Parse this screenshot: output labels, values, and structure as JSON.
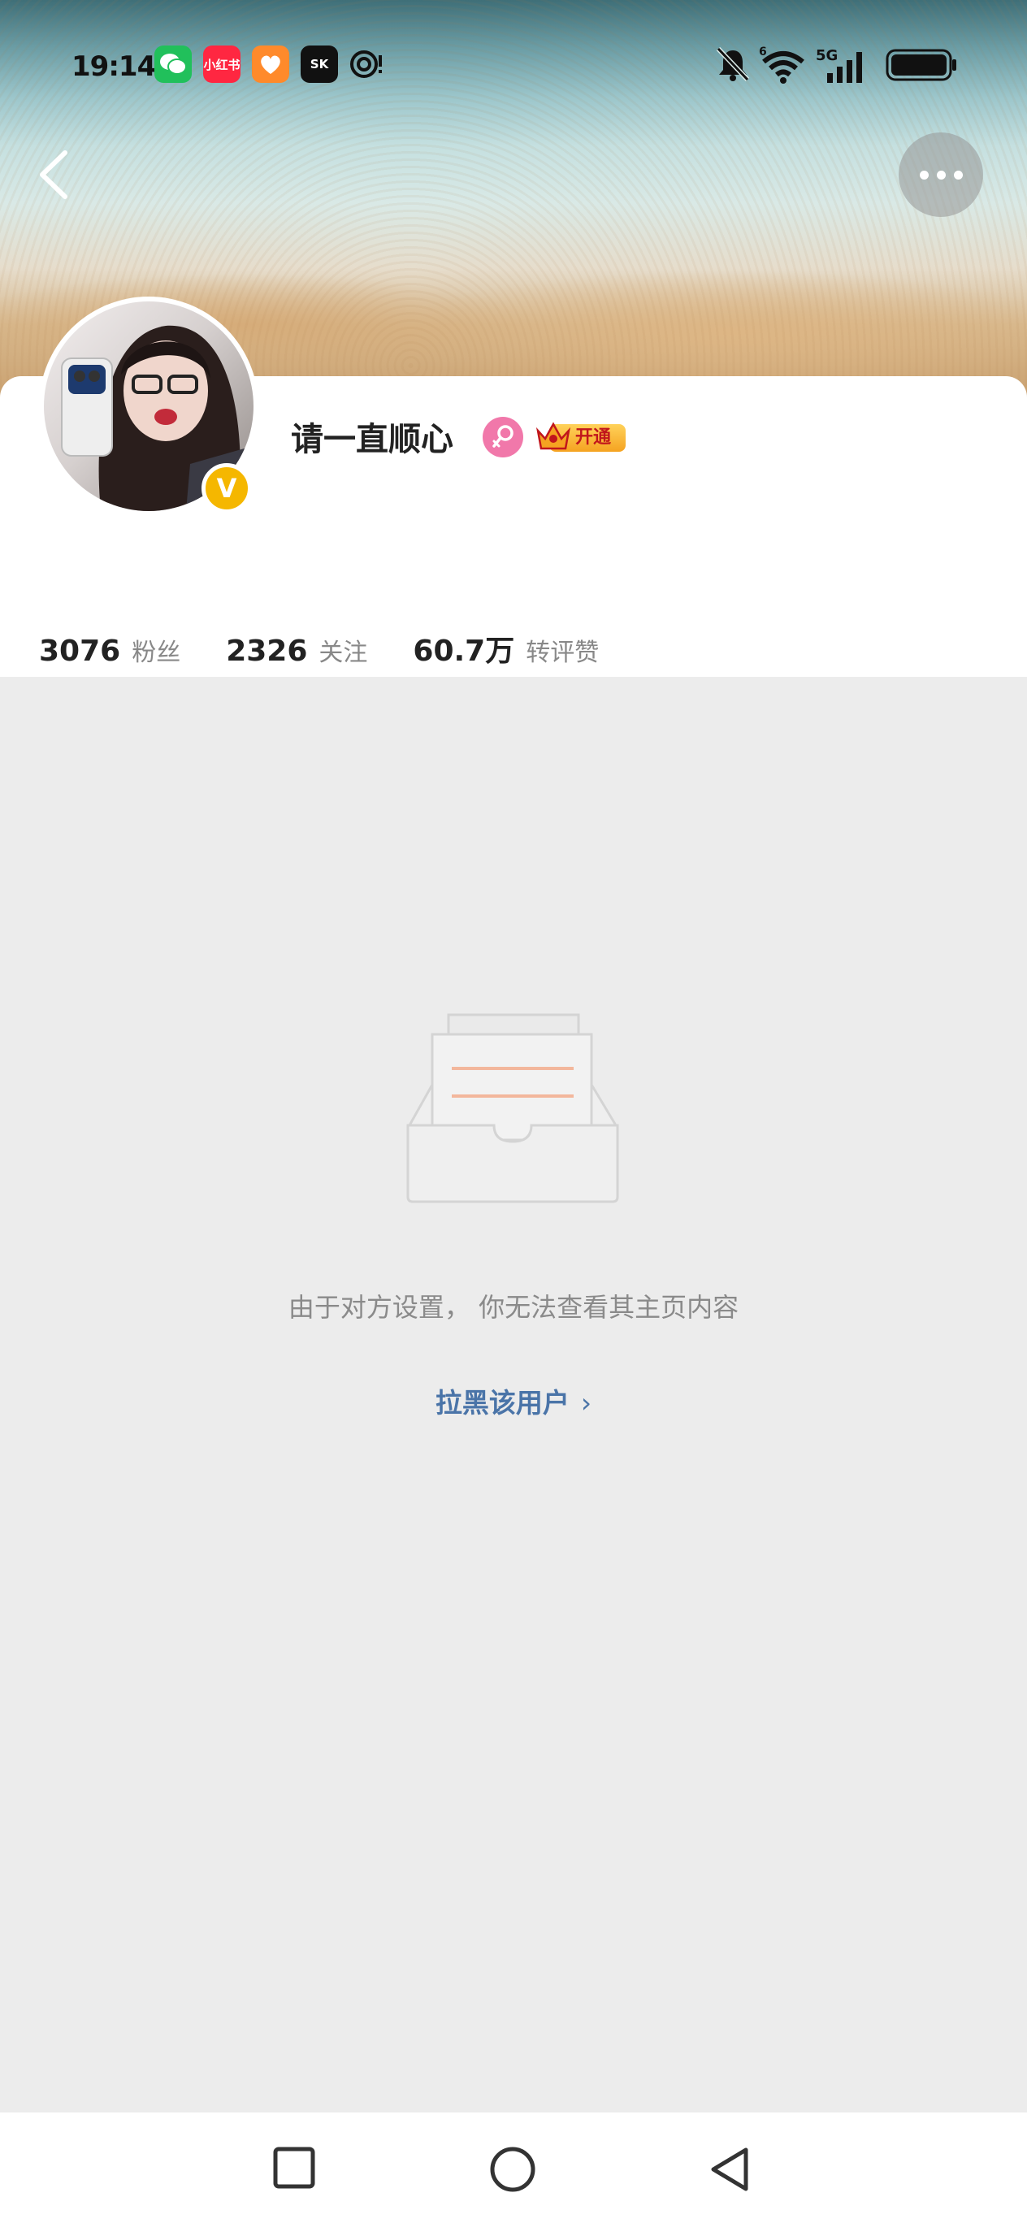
{
  "status_bar": {
    "time": "19:14",
    "apps": [
      {
        "icon": "wechat-icon",
        "label": "",
        "color": "#21c05b"
      },
      {
        "icon": "xiaohongshu-icon",
        "label": "小红书",
        "color": "#ff2741"
      },
      {
        "icon": "heart-app-icon",
        "label": "",
        "color": "#ff8a2b"
      },
      {
        "icon": "skr-app-icon",
        "label": "SK",
        "color": "#111111"
      },
      {
        "icon": "spiral-icon",
        "label": "!",
        "color": "#111111"
      }
    ],
    "signal": "5G",
    "wifi_badge": "6"
  },
  "profile": {
    "username": "请一直顺心",
    "vip_label": "开通",
    "verified_badge": "V",
    "stats": [
      {
        "value": "3076",
        "label": "粉丝"
      },
      {
        "value": "2326",
        "label": "关注"
      },
      {
        "value": "60.7万",
        "label": "转评赞"
      }
    ]
  },
  "empty_state": {
    "message": "由于对方设置， 你无法查看其主页内容",
    "block_link": "拉黑该用户",
    "block_chevron": "›"
  },
  "colors": {
    "link": "#4a74a8",
    "gender": "#f178aa",
    "verified": "#f5b700"
  }
}
